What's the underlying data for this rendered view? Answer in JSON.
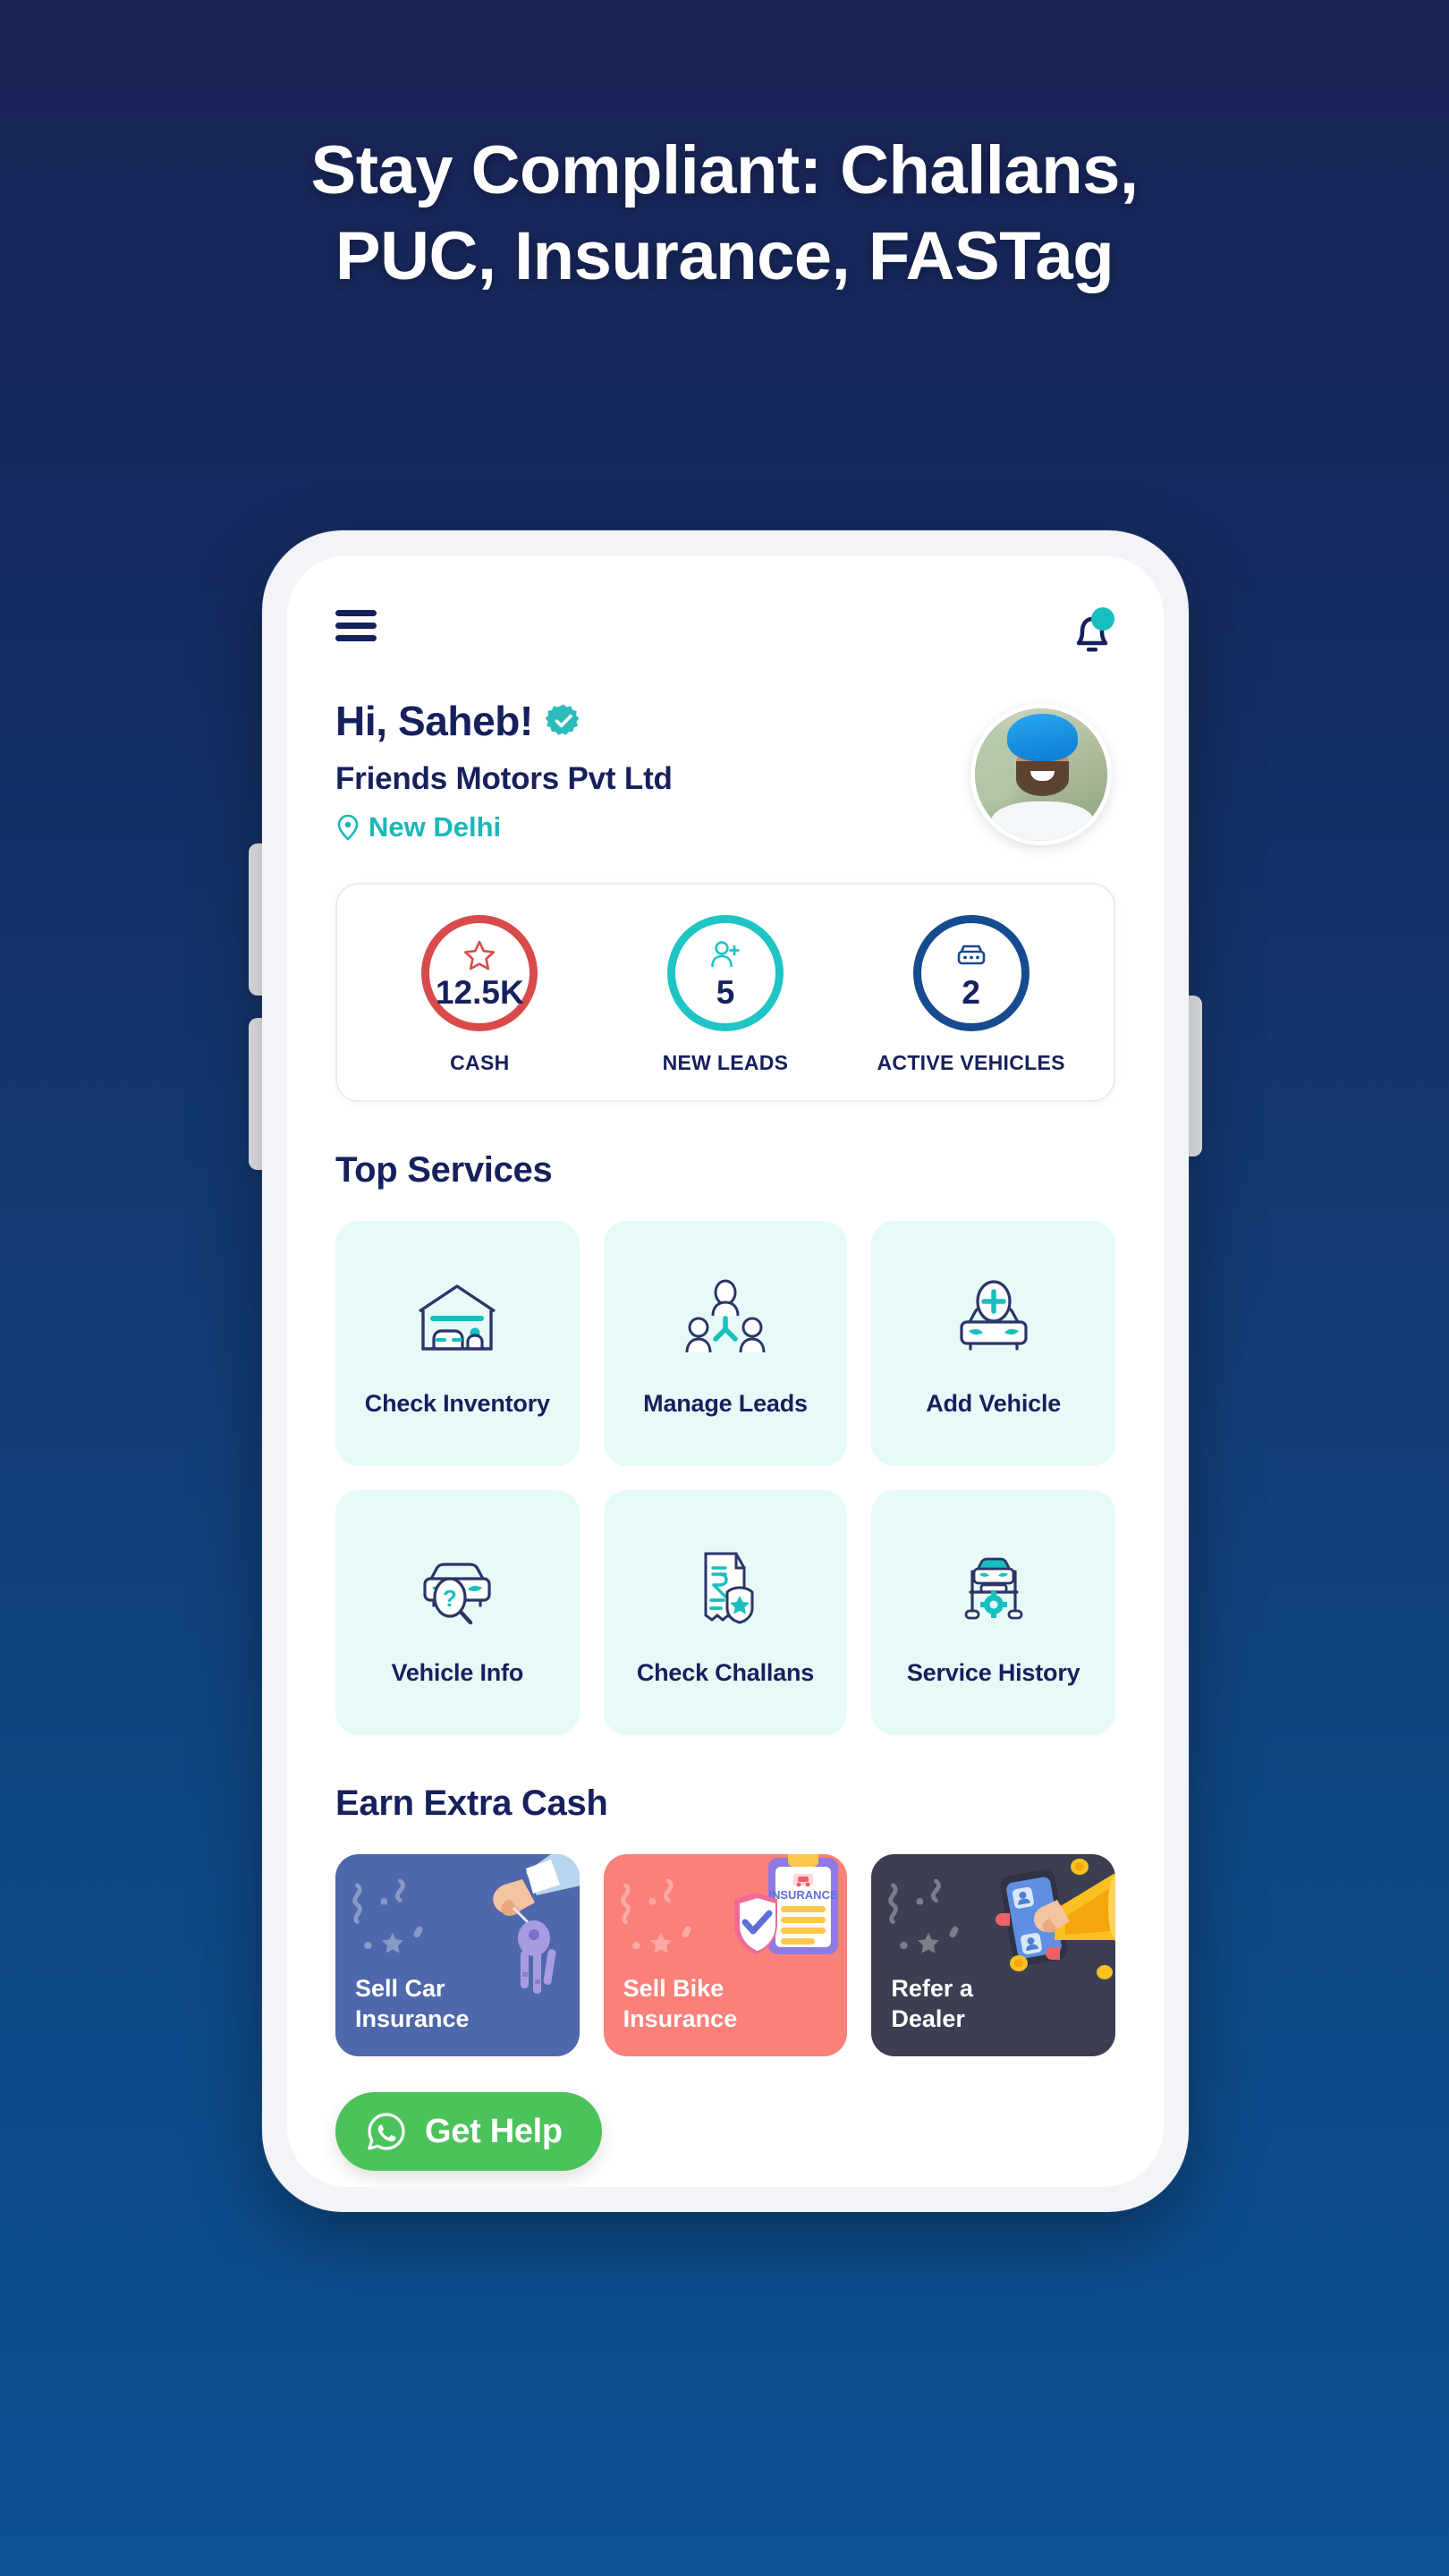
{
  "headline": {
    "line1_bold": "Stay Compliant:",
    "line1_rest": " Challans,",
    "line2": "PUC, Insurance, FASTag"
  },
  "app": {
    "topbar": {
      "menu_icon": "hamburger-menu-icon",
      "bell_icon": "notification-bell-icon",
      "has_notification_dot": true,
      "dot_color": "#19bfbf"
    },
    "greeting": {
      "name": "Hi, Saheb!",
      "verified_icon": "verified-badge-icon",
      "company": "Friends Motors Pvt Ltd",
      "location": "New Delhi",
      "location_icon": "location-pin-icon",
      "avatar_alt": "user-avatar"
    },
    "stats": [
      {
        "value": "12.5K",
        "label": "CASH",
        "color": "#d94a4a",
        "icon": "star-outline-icon"
      },
      {
        "value": "5",
        "label": "NEW LEADS",
        "color": "#1fc4c4",
        "icon": "add-person-icon"
      },
      {
        "value": "2",
        "label": "ACTIVE VEHICLES",
        "color": "#164b8f",
        "icon": "car-front-icon"
      }
    ],
    "top_services": {
      "title": "Top Services",
      "items": [
        {
          "label": "Check Inventory",
          "icon": "garage-car-bike-icon"
        },
        {
          "label": "Manage Leads",
          "icon": "people-network-icon"
        },
        {
          "label": "Add Vehicle",
          "icon": "car-plus-icon"
        },
        {
          "label": "Vehicle Info",
          "icon": "car-magnifier-question-icon"
        },
        {
          "label": "Check Challans",
          "icon": "rupee-receipt-badge-icon"
        },
        {
          "label": "Service History",
          "icon": "car-lift-gear-icon"
        }
      ]
    },
    "earn_extra": {
      "title": "Earn Extra Cash",
      "items": [
        {
          "label_line1": "Sell Car",
          "label_line2": "Insurance",
          "bg": "#4f67ab",
          "art": "hand-holding-keys-icon"
        },
        {
          "label_line1": "Sell Bike",
          "label_line2": "Insurance",
          "bg": "#fa8079",
          "art": "insurance-clipboard-shield-icon"
        },
        {
          "label_line1": "Refer a",
          "label_line2": "Dealer",
          "bg": "#3b3f51",
          "art": "megaphone-phone-coins-icon"
        }
      ]
    },
    "help": {
      "label": "Get Help",
      "icon": "whatsapp-icon",
      "color": "#4cc25b"
    }
  },
  "theme": {
    "bg_top": "#1a2456",
    "bg_bottom": "#0d5294",
    "navy": "#16205c",
    "teal": "#17b8b8",
    "service_tile_bg": "#e6fbf8"
  }
}
